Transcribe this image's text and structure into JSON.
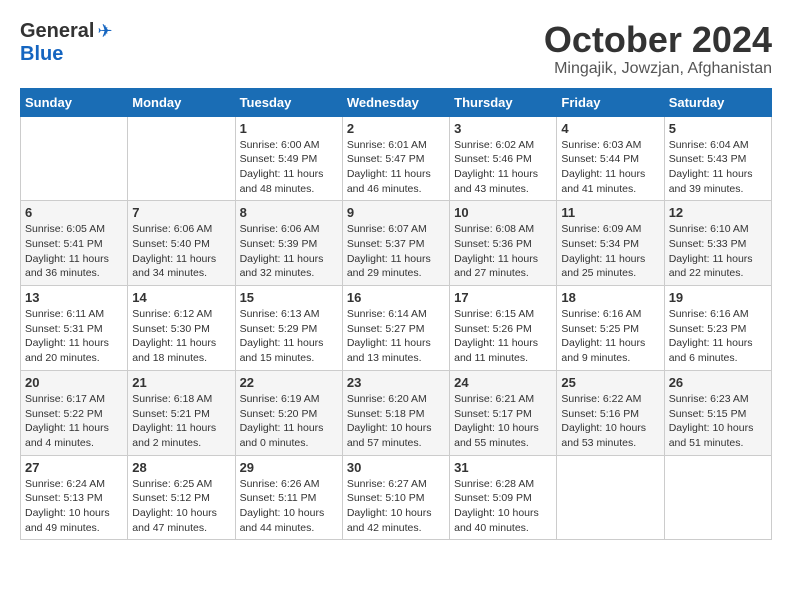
{
  "header": {
    "logo": {
      "general": "General",
      "blue": "Blue"
    },
    "title": "October 2024",
    "location": "Mingajik, Jowzjan, Afghanistan"
  },
  "weekdays": [
    "Sunday",
    "Monday",
    "Tuesday",
    "Wednesday",
    "Thursday",
    "Friday",
    "Saturday"
  ],
  "weeks": [
    [
      {
        "day": null,
        "info": null
      },
      {
        "day": null,
        "info": null
      },
      {
        "day": "1",
        "info": "Sunrise: 6:00 AM\nSunset: 5:49 PM\nDaylight: 11 hours and 48 minutes."
      },
      {
        "day": "2",
        "info": "Sunrise: 6:01 AM\nSunset: 5:47 PM\nDaylight: 11 hours and 46 minutes."
      },
      {
        "day": "3",
        "info": "Sunrise: 6:02 AM\nSunset: 5:46 PM\nDaylight: 11 hours and 43 minutes."
      },
      {
        "day": "4",
        "info": "Sunrise: 6:03 AM\nSunset: 5:44 PM\nDaylight: 11 hours and 41 minutes."
      },
      {
        "day": "5",
        "info": "Sunrise: 6:04 AM\nSunset: 5:43 PM\nDaylight: 11 hours and 39 minutes."
      }
    ],
    [
      {
        "day": "6",
        "info": "Sunrise: 6:05 AM\nSunset: 5:41 PM\nDaylight: 11 hours and 36 minutes."
      },
      {
        "day": "7",
        "info": "Sunrise: 6:06 AM\nSunset: 5:40 PM\nDaylight: 11 hours and 34 minutes."
      },
      {
        "day": "8",
        "info": "Sunrise: 6:06 AM\nSunset: 5:39 PM\nDaylight: 11 hours and 32 minutes."
      },
      {
        "day": "9",
        "info": "Sunrise: 6:07 AM\nSunset: 5:37 PM\nDaylight: 11 hours and 29 minutes."
      },
      {
        "day": "10",
        "info": "Sunrise: 6:08 AM\nSunset: 5:36 PM\nDaylight: 11 hours and 27 minutes."
      },
      {
        "day": "11",
        "info": "Sunrise: 6:09 AM\nSunset: 5:34 PM\nDaylight: 11 hours and 25 minutes."
      },
      {
        "day": "12",
        "info": "Sunrise: 6:10 AM\nSunset: 5:33 PM\nDaylight: 11 hours and 22 minutes."
      }
    ],
    [
      {
        "day": "13",
        "info": "Sunrise: 6:11 AM\nSunset: 5:31 PM\nDaylight: 11 hours and 20 minutes."
      },
      {
        "day": "14",
        "info": "Sunrise: 6:12 AM\nSunset: 5:30 PM\nDaylight: 11 hours and 18 minutes."
      },
      {
        "day": "15",
        "info": "Sunrise: 6:13 AM\nSunset: 5:29 PM\nDaylight: 11 hours and 15 minutes."
      },
      {
        "day": "16",
        "info": "Sunrise: 6:14 AM\nSunset: 5:27 PM\nDaylight: 11 hours and 13 minutes."
      },
      {
        "day": "17",
        "info": "Sunrise: 6:15 AM\nSunset: 5:26 PM\nDaylight: 11 hours and 11 minutes."
      },
      {
        "day": "18",
        "info": "Sunrise: 6:16 AM\nSunset: 5:25 PM\nDaylight: 11 hours and 9 minutes."
      },
      {
        "day": "19",
        "info": "Sunrise: 6:16 AM\nSunset: 5:23 PM\nDaylight: 11 hours and 6 minutes."
      }
    ],
    [
      {
        "day": "20",
        "info": "Sunrise: 6:17 AM\nSunset: 5:22 PM\nDaylight: 11 hours and 4 minutes."
      },
      {
        "day": "21",
        "info": "Sunrise: 6:18 AM\nSunset: 5:21 PM\nDaylight: 11 hours and 2 minutes."
      },
      {
        "day": "22",
        "info": "Sunrise: 6:19 AM\nSunset: 5:20 PM\nDaylight: 11 hours and 0 minutes."
      },
      {
        "day": "23",
        "info": "Sunrise: 6:20 AM\nSunset: 5:18 PM\nDaylight: 10 hours and 57 minutes."
      },
      {
        "day": "24",
        "info": "Sunrise: 6:21 AM\nSunset: 5:17 PM\nDaylight: 10 hours and 55 minutes."
      },
      {
        "day": "25",
        "info": "Sunrise: 6:22 AM\nSunset: 5:16 PM\nDaylight: 10 hours and 53 minutes."
      },
      {
        "day": "26",
        "info": "Sunrise: 6:23 AM\nSunset: 5:15 PM\nDaylight: 10 hours and 51 minutes."
      }
    ],
    [
      {
        "day": "27",
        "info": "Sunrise: 6:24 AM\nSunset: 5:13 PM\nDaylight: 10 hours and 49 minutes."
      },
      {
        "day": "28",
        "info": "Sunrise: 6:25 AM\nSunset: 5:12 PM\nDaylight: 10 hours and 47 minutes."
      },
      {
        "day": "29",
        "info": "Sunrise: 6:26 AM\nSunset: 5:11 PM\nDaylight: 10 hours and 44 minutes."
      },
      {
        "day": "30",
        "info": "Sunrise: 6:27 AM\nSunset: 5:10 PM\nDaylight: 10 hours and 42 minutes."
      },
      {
        "day": "31",
        "info": "Sunrise: 6:28 AM\nSunset: 5:09 PM\nDaylight: 10 hours and 40 minutes."
      },
      {
        "day": null,
        "info": null
      },
      {
        "day": null,
        "info": null
      }
    ]
  ]
}
